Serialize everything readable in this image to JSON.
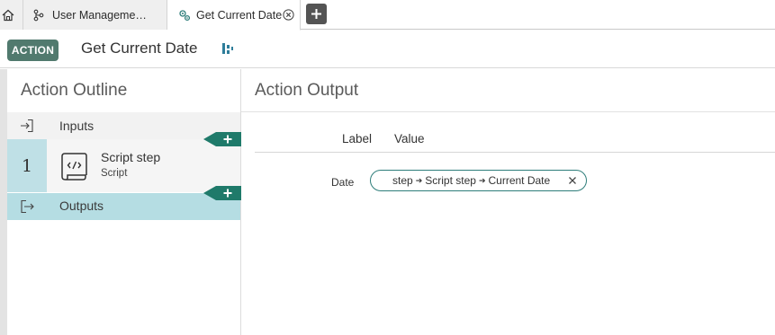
{
  "tabs": [
    {
      "name": "home",
      "icon": "home-icon"
    },
    {
      "name": "user-management",
      "label": "User Manageme…",
      "icon": "branch-icon"
    },
    {
      "name": "get-current-date",
      "label": "Get Current Date",
      "icon": "gear-cluster-icon",
      "active": true
    }
  ],
  "header": {
    "badge": "ACTION",
    "title": "Get Current Date",
    "icon": "flow-diagram-icon"
  },
  "outline": {
    "title": "Action Outline",
    "inputs_label": "Inputs",
    "step": {
      "number": "1",
      "title": "Script step",
      "subtitle": "Script",
      "icon": "script-scroll-icon"
    },
    "outputs_label": "Outputs",
    "insert_symbol": "+"
  },
  "output": {
    "title": "Action Output",
    "col_label": "Label",
    "col_value": "Value",
    "rows": [
      {
        "label": "Date",
        "path": [
          "step",
          "Script step",
          "Current Date"
        ]
      }
    ]
  },
  "colors": {
    "accent": "#517a6e",
    "selection": "#b5dde3",
    "step_number_bg": "#bfe0e6",
    "pill_border": "#2e7d7a",
    "insert_green": "#1f7a6a"
  }
}
